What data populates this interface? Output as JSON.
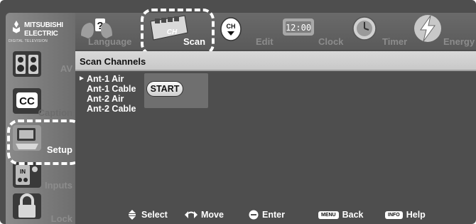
{
  "brand": {
    "name_line1": "MITSUBISHI",
    "name_line2": "ELECTRIC",
    "tagline": "DIGITAL TELEVISION"
  },
  "sidebar": {
    "items": [
      {
        "label": "AV",
        "icon": "speakers-icon"
      },
      {
        "label": "Caption",
        "icon": "cc-icon"
      },
      {
        "label": "Setup",
        "icon": "tv-setup-icon",
        "active": true
      },
      {
        "label": "Inputs",
        "icon": "inputs-icon"
      },
      {
        "label": "Lock",
        "icon": "padlock-icon"
      }
    ]
  },
  "tabs": [
    {
      "label": "Language",
      "icon": "language-icon"
    },
    {
      "label": "Scan",
      "icon": "scan-icon",
      "active": true
    },
    {
      "label": "",
      "icon": "channel-icon"
    },
    {
      "label": "Edit",
      "icon": "edit-icon"
    },
    {
      "label": "Clock",
      "icon": "clock-icon"
    },
    {
      "label": "Timer",
      "icon": "timer-icon"
    },
    {
      "label": "Energy",
      "icon": "energy-icon"
    }
  ],
  "tab_extra": {
    "ch_badge": "CH",
    "clock_time": "12:00",
    "scan_ch": "CH"
  },
  "section": {
    "title": "Scan Channels"
  },
  "channels": {
    "selected_index": 0,
    "items": [
      "Ant-1 Air",
      "Ant-1 Cable",
      "Ant-2 Air",
      "Ant-2 Cable"
    ]
  },
  "start": {
    "label": "START"
  },
  "hints": [
    {
      "label": "Select",
      "icon": "updown-arrows-icon"
    },
    {
      "label": "Move",
      "icon": "leftright-arrows-icon"
    },
    {
      "label": "Enter",
      "icon": "enter-icon"
    },
    {
      "label": "Back",
      "key": "MENU"
    },
    {
      "label": "Help",
      "key": "INFO"
    }
  ],
  "colors": {
    "background": "#4e4e4e",
    "header_bar": "#d0d0d0",
    "active_text": "#ffffff",
    "inactive_text": "#8c8c8c"
  }
}
